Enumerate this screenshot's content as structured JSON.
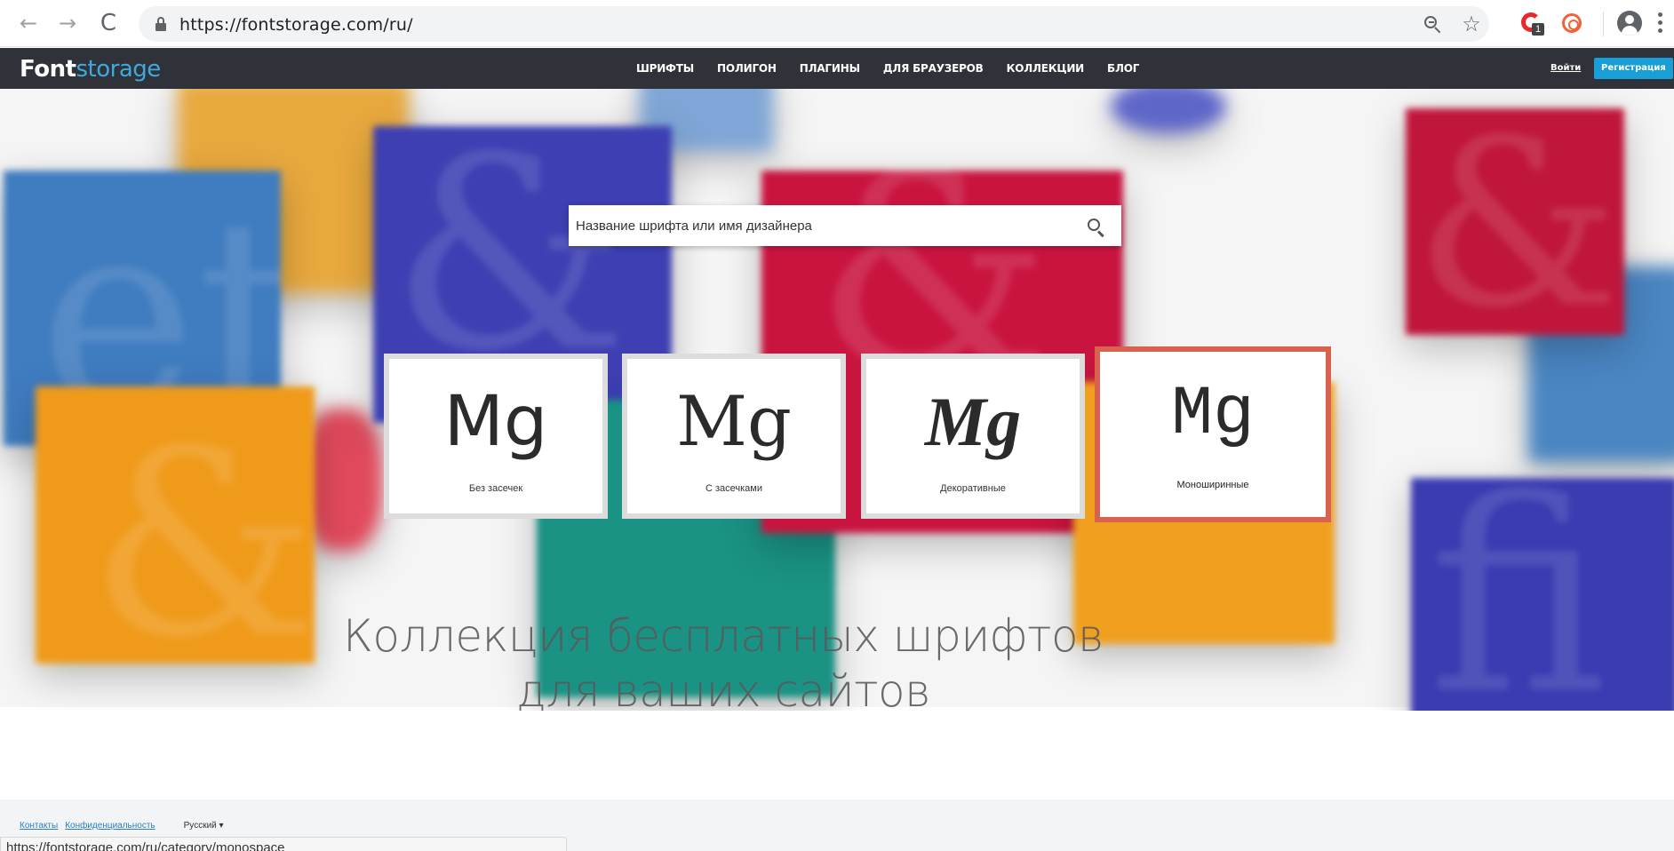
{
  "browser": {
    "url": "https://fontstorage.com/ru/",
    "icons": [
      "back-arrow-icon",
      "forward-arrow-icon",
      "reload-icon",
      "lock-icon",
      "zoom-icon",
      "star-icon",
      "extension-icon",
      "extension-target-icon",
      "profile-icon",
      "menu-icon"
    ],
    "back_glyph": "←",
    "forward_glyph": "→",
    "reload_glyph": "C",
    "star_glyph": "☆",
    "extension_badge": "1",
    "status_url": "https://fontstorage.com/ru/category/monospace"
  },
  "header": {
    "logo_primary": "Font",
    "logo_secondary": "storage",
    "nav": [
      "ШРИФТЫ",
      "ПОЛИГОН",
      "ПЛАГИНЫ",
      "ДЛЯ БРАУЗЕРОВ",
      "КОЛЛЕКЦИИ",
      "БЛОГ"
    ],
    "login": "Войти",
    "register": "Регистрация",
    "colors": {
      "bar": "#2f3238",
      "logo_accent": "#3fa9de",
      "register_bg": "#1a9ed8"
    }
  },
  "hero": {
    "search_placeholder": "Название шрифта или имя дизайнера",
    "categories": [
      {
        "specimen": "Mg",
        "label": "Без засечек"
      },
      {
        "specimen": "Mg",
        "label": "С засечками"
      },
      {
        "specimen": "Mg",
        "label": "Декоративные"
      },
      {
        "specimen": "Mg",
        "label": "Моноширинные",
        "active": true
      }
    ],
    "tagline_line1": "Коллекция бесплатных шрифтов",
    "tagline_line2": "для ваших сайтов",
    "tile_glyphs": [
      "&",
      "et",
      "&",
      "&",
      "f",
      "fi"
    ],
    "colors": {
      "active_border": "#d9624e",
      "blue": "#3b6fb3",
      "indigo": "#3b3db0",
      "crimson": "#c2123d",
      "orange": "#f09a1a",
      "teal": "#1a8f85"
    }
  },
  "footer": {
    "links": [
      "Контакты",
      "Конфиденциальность"
    ],
    "language": "Русский ▾"
  }
}
